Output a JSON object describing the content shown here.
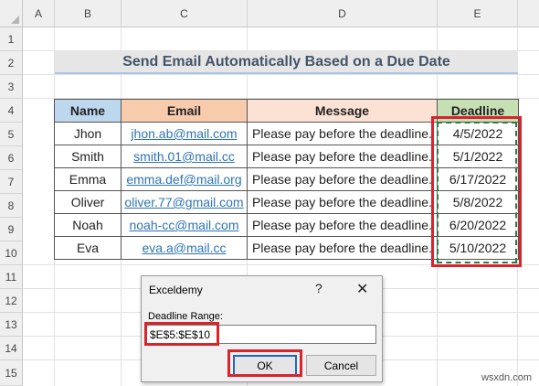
{
  "columns": [
    "A",
    "B",
    "C",
    "D",
    "E"
  ],
  "rows": [
    "1",
    "2",
    "3",
    "4",
    "5",
    "6",
    "7",
    "8",
    "9",
    "10",
    "11",
    "12",
    "13",
    "14",
    "15"
  ],
  "title": "Send Email Automatically Based on a Due Date",
  "table": {
    "headers": [
      "Name",
      "Email",
      "Message",
      "Deadline"
    ],
    "rows": [
      {
        "name": "Jhon",
        "email": "jhon.ab@mail.com",
        "message": "Please pay before the deadline.",
        "deadline": "4/5/2022"
      },
      {
        "name": "Smith",
        "email": "smith.01@mail.cc",
        "message": "Please pay before the deadline.",
        "deadline": "5/1/2022"
      },
      {
        "name": "Emma",
        "email": "emma.def@mail.org",
        "message": "Please pay before the deadline.",
        "deadline": "6/17/2022"
      },
      {
        "name": "Oliver",
        "email": "oliver.77@gmail.com",
        "message": "Please pay before the deadline.",
        "deadline": "5/8/2022"
      },
      {
        "name": "Noah",
        "email": "noah-cc@mail.com",
        "message": "Please pay before the deadline.",
        "deadline": "6/20/2022"
      },
      {
        "name": "Eva",
        "email": "eva.a@mail.cc",
        "message": "Please pay before the deadline.",
        "deadline": "5/10/2022"
      }
    ]
  },
  "dialog": {
    "title": "Exceldemy",
    "help": "?",
    "close": "✕",
    "label": "Deadline Range:",
    "input_value": "$E$5:$E$10",
    "ok": "OK",
    "cancel": "Cancel"
  },
  "watermark": "wsxdn.com",
  "colors": {
    "highlight": "#d9232d",
    "marquee": "#2f7a3f",
    "title_text": "#44546a"
  }
}
